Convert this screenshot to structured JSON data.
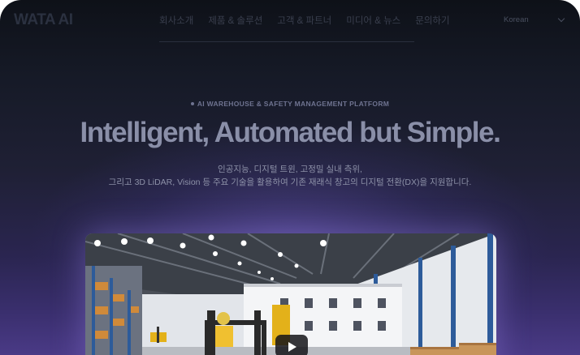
{
  "brand": {
    "logo_text": "WATA AI"
  },
  "nav": {
    "items": [
      {
        "label": "회사소개"
      },
      {
        "label": "제품 & 솔루션"
      },
      {
        "label": "고객 & 파트너"
      },
      {
        "label": "미디어 & 뉴스"
      },
      {
        "label": "문의하기"
      }
    ],
    "language": {
      "selected": "Korean"
    }
  },
  "hero": {
    "eyebrow": "AI WAREHOUSE & SAFETY MANAGEMENT PLATFORM",
    "headline": "Intelligent, Automated but Simple.",
    "description_line1": "인공지능, 디지털 트윈, 고정밀 실내 측위,",
    "description_line2": "그리고 3D LiDAR, Vision 등 주요 기술을 활용하여  기존 재래식 창고의 디지털 전환(DX)을 지원합니다."
  },
  "video": {
    "icon": "play-icon"
  },
  "colors": {
    "background_top": "#0e1118",
    "background_bottom": "#4a3a86",
    "glow": "#8c78e6"
  }
}
